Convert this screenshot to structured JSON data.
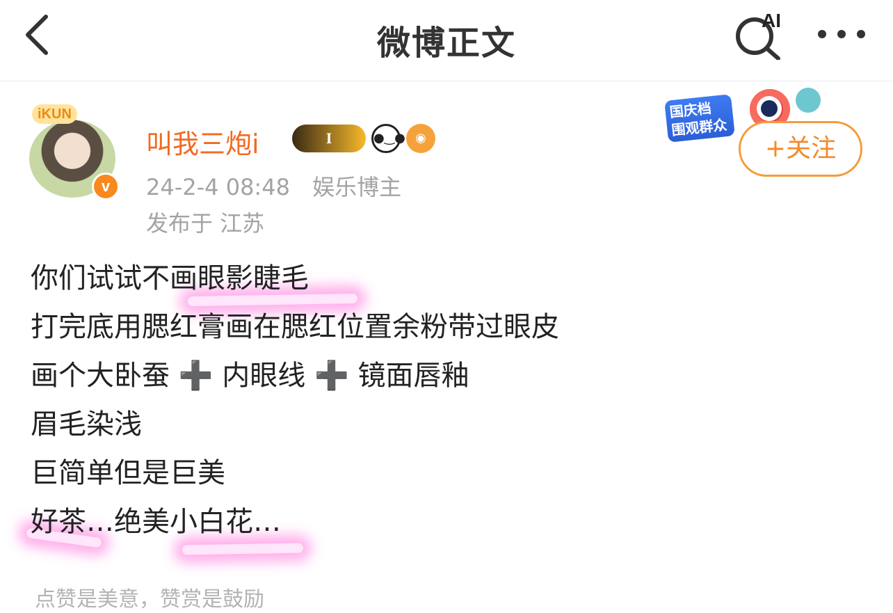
{
  "navbar": {
    "title": "微博正文",
    "ai_label": "AI",
    "icons": [
      "back-icon",
      "ai-search-icon",
      "more-icon"
    ]
  },
  "author": {
    "name": "叫我三炮i",
    "avatar_frame_text": "iKUN",
    "verify_mark": "v",
    "badges": [
      {
        "name": "crown-level-badge",
        "text": "I"
      },
      {
        "name": "panda-badge"
      },
      {
        "name": "fish-badge"
      }
    ],
    "timestamp": "24-2-4 08:48",
    "category": "娱乐博主",
    "location": "发布于 江苏"
  },
  "promo": {
    "text": "国庆档 围观群众"
  },
  "follow_button": {
    "label": "+关注"
  },
  "post": {
    "lines": [
      "你们试试不画眼影睫毛",
      "打完底用腮红膏画在腮红位置余粉带过眼皮",
      "画个大卧蚕 ➕ 内眼线 ➕ 镜面唇釉",
      "眉毛染浅",
      "巨简单但是巨美",
      "好茶…绝美小白花…"
    ]
  },
  "reward_hint": "点赞是美意，赞赏是鼓励",
  "colors": {
    "username": "#f26a22",
    "follow_border": "#f59b3b",
    "meta_gray": "#a3a3a3",
    "highlight_pink": "#ff50d2"
  }
}
